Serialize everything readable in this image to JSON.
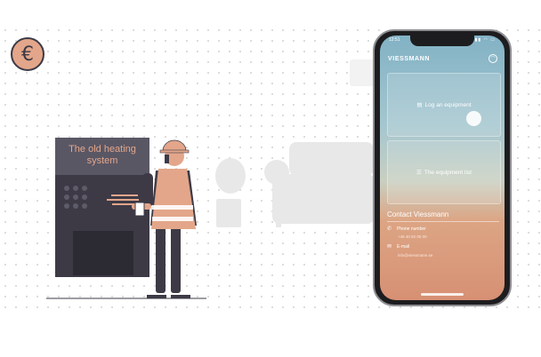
{
  "currency_icon": "euro-sign-icon",
  "currency_symbol": "€",
  "boiler": {
    "label": "The old heating system"
  },
  "phone": {
    "status_time": "12:51",
    "status_icons": "▮▮ ◠ ▭",
    "brand": "VIESSMANN",
    "user_icon": "user-icon",
    "cards": [
      {
        "icon": "▤",
        "label": "Log an equipment"
      },
      {
        "icon": "☰",
        "label": "The equipment list"
      }
    ],
    "contact": {
      "title": "Contact Viessmann",
      "phone_label": "Phone number",
      "phone_value": "+46 40 82 05 00",
      "email_label": "E-mail",
      "email_value": "info@viessmann.se"
    }
  },
  "colors": {
    "accent": "#e3a68a",
    "dark": "#3d3a46",
    "ghost": "#e7e7e7"
  }
}
